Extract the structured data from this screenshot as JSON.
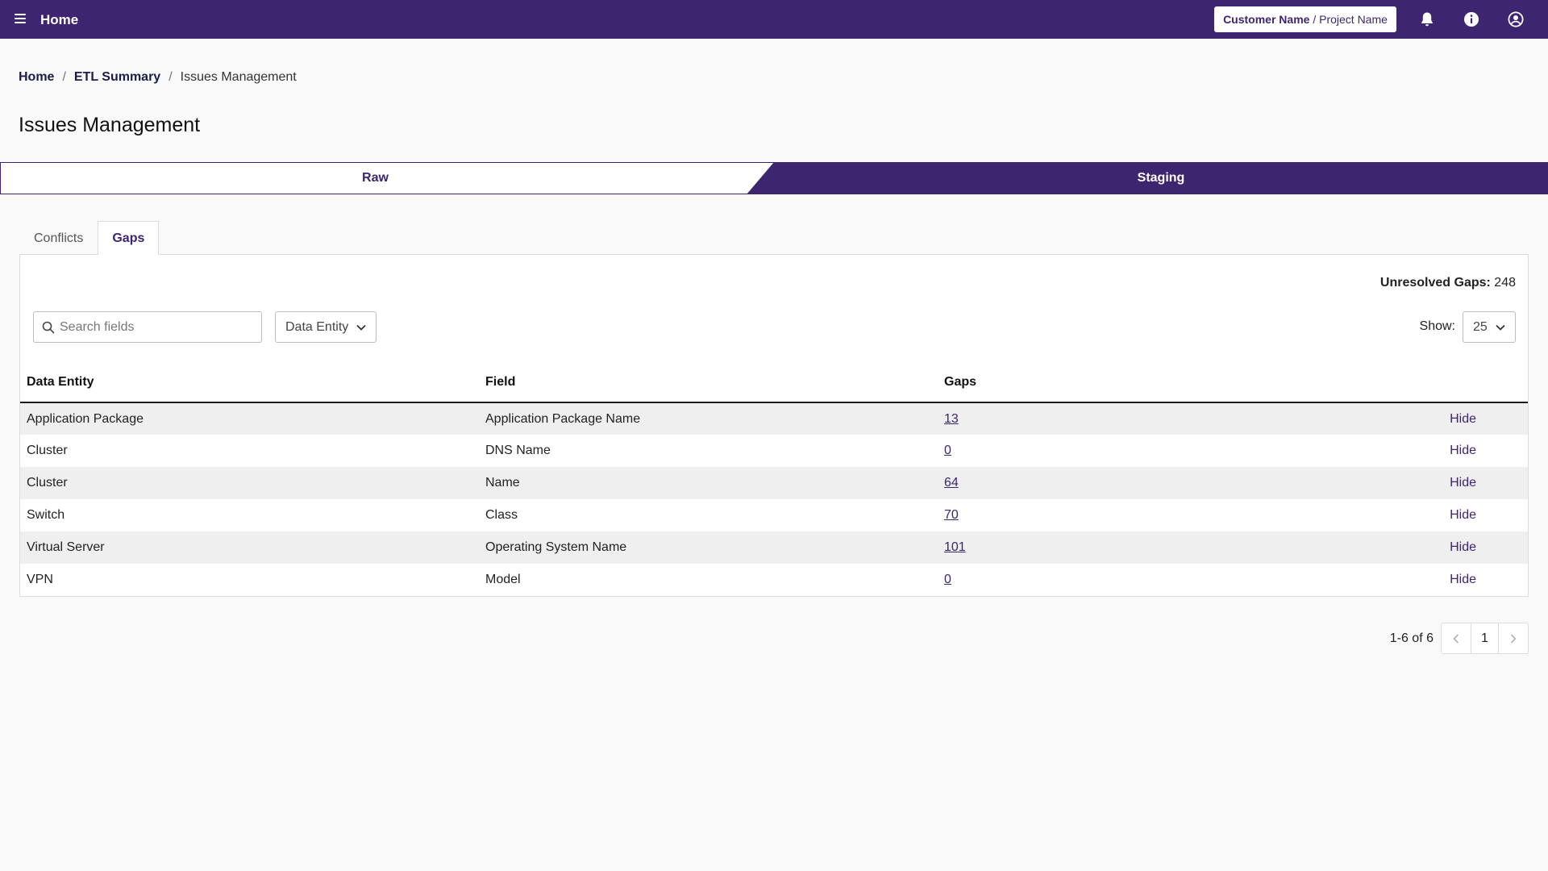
{
  "header": {
    "title": "Home",
    "customer": "Customer Name",
    "separator": " / ",
    "project": "Project Name"
  },
  "breadcrumb": {
    "home": "Home",
    "etl": "ETL Summary",
    "current": "Issues Management",
    "sep": "/"
  },
  "page_title": "Issues Management",
  "stages": {
    "raw": "Raw",
    "staging": "Staging"
  },
  "tabs": {
    "conflicts": "Conflicts",
    "gaps": "Gaps"
  },
  "summary": {
    "label": "Unresolved Gaps:",
    "value": "248"
  },
  "search": {
    "placeholder": "Search fields"
  },
  "filter": {
    "selected": "Data Entity"
  },
  "show": {
    "label": "Show:",
    "value": "25"
  },
  "table": {
    "headers": {
      "entity": "Data Entity",
      "field": "Field",
      "gaps": "Gaps"
    },
    "rows": [
      {
        "entity": "Application Package",
        "field": "Application Package Name",
        "gaps": "13",
        "action": "Hide"
      },
      {
        "entity": "Cluster",
        "field": "DNS Name",
        "gaps": "0",
        "action": "Hide"
      },
      {
        "entity": "Cluster",
        "field": "Name",
        "gaps": "64",
        "action": "Hide"
      },
      {
        "entity": "Switch",
        "field": "Class",
        "gaps": "70",
        "action": "Hide"
      },
      {
        "entity": "Virtual Server",
        "field": "Operating System Name",
        "gaps": "101",
        "action": "Hide"
      },
      {
        "entity": "VPN",
        "field": "Model",
        "gaps": "0",
        "action": "Hide"
      }
    ]
  },
  "pagination": {
    "range": "1-6 of 6",
    "page": "1"
  },
  "colors": {
    "brand": "#3d2570",
    "background": "#f9f9f9",
    "row_alt": "#efefef"
  }
}
